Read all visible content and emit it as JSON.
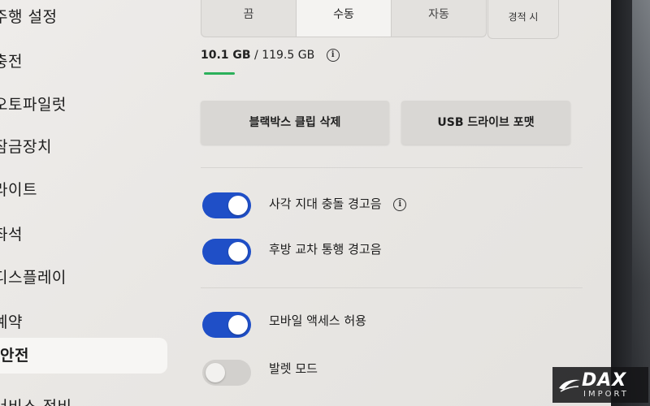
{
  "sidebar": {
    "items": [
      {
        "label": "주행 설정"
      },
      {
        "label": "충전"
      },
      {
        "label": "오토파일럿"
      },
      {
        "label": "잠금장치"
      },
      {
        "label": "라이트"
      },
      {
        "label": "좌석"
      },
      {
        "label": "디스플레이"
      },
      {
        "label": "예약"
      },
      {
        "label": "안전"
      },
      {
        "label": "서비스 정비"
      }
    ],
    "active_index": 8
  },
  "recording_mode": {
    "options": [
      "끔",
      "수동",
      "자동"
    ],
    "selected": "수동",
    "extra_option": "경적 시"
  },
  "storage": {
    "used": "10.1 GB",
    "separator": " / ",
    "total": "119.5 GB",
    "usage_fraction": 0.085,
    "usage_color": "#2bb05a"
  },
  "buttons": {
    "delete_clips": "블랙박스 클립 삭제",
    "format_usb": "USB 드라이브 포맷"
  },
  "toggles": [
    {
      "label": "사각 지대 충돌 경고음",
      "on": true,
      "has_info": true
    },
    {
      "label": "후방 교차 통행 경고음",
      "on": true,
      "has_info": false
    },
    {
      "label": "모바일 액세스 허용",
      "on": true,
      "has_info": false
    },
    {
      "label": "발렛 모드",
      "on": false,
      "has_info": false
    }
  ],
  "colors": {
    "toggle_on": "#1f4fc7",
    "toggle_off": "#d2d0cd"
  },
  "watermark": {
    "main": "DAX",
    "sub": "IMPORT"
  }
}
